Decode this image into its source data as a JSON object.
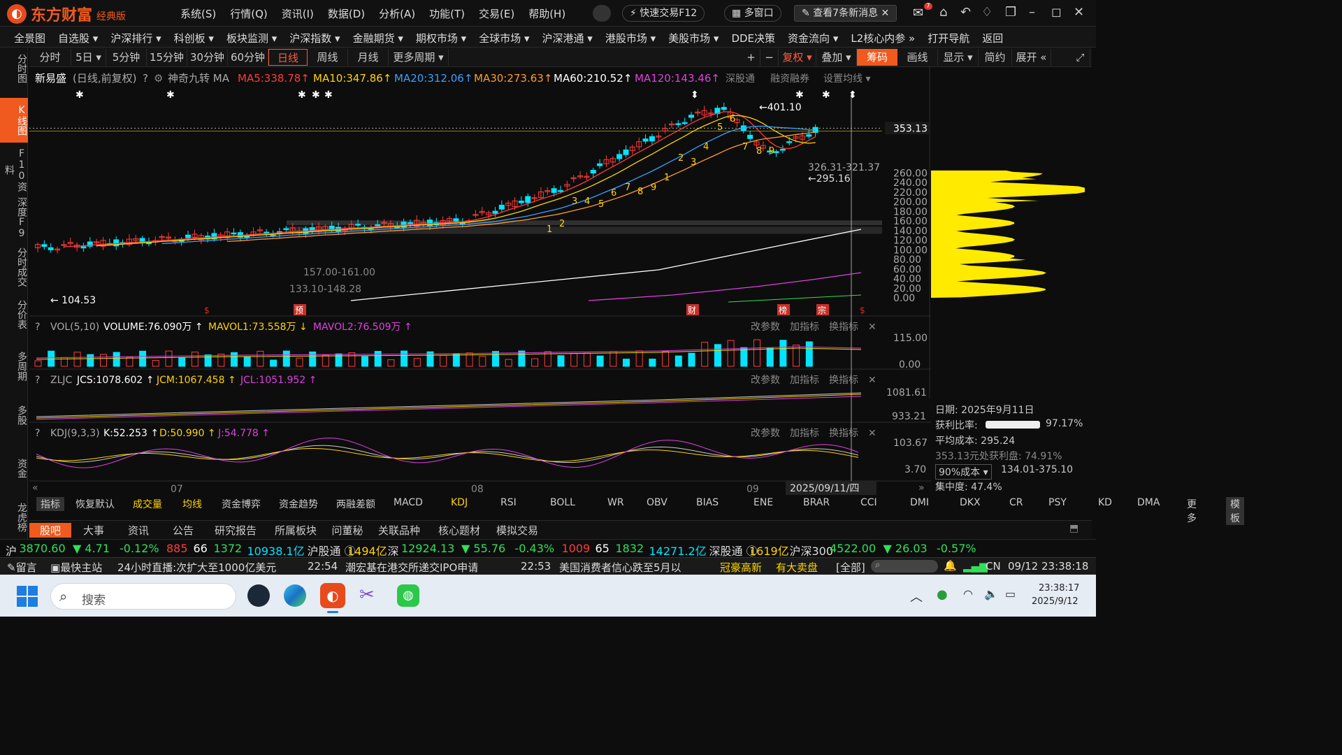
{
  "app": {
    "name": "东方财富",
    "edition": "经典版"
  },
  "top_menu": [
    "系统(S)",
    "行情(Q)",
    "资讯(I)",
    "数据(D)",
    "分析(A)",
    "功能(T)",
    "交易(E)",
    "帮助(H)"
  ],
  "top_right": {
    "quick_trade": "快速交易F12",
    "multi_window": "多窗口",
    "news_notice": "查看7条新消息",
    "badge": "7"
  },
  "navbar": [
    "全景图",
    "自选股 ▾",
    "沪深排行 ▾",
    "科创板 ▾",
    "板块监测 ▾",
    "沪深指数 ▾",
    "金融期货 ▾",
    "期权市场 ▾",
    "全球市场 ▾",
    "沪深港通 ▾",
    "港股市场 ▾",
    "美股市场 ▾",
    "DDE决策",
    "资金流向 ▾",
    "L2核心内参 »",
    "打开导航",
    "返回"
  ],
  "leftbar": [
    {
      "label": "分时图",
      "active": false
    },
    {
      "label": "K线图",
      "active": true
    },
    {
      "label": "F10资料",
      "active": false
    },
    {
      "label": "深度F9",
      "active": false
    },
    {
      "label": "分时成交",
      "active": false
    },
    {
      "label": "分价表",
      "active": false
    },
    {
      "label": "多周期",
      "active": false
    },
    {
      "label": "多股",
      "active": false
    },
    {
      "label": "资金",
      "active": false
    },
    {
      "label": "龙虎榜",
      "active": false
    }
  ],
  "periods": [
    "分时",
    "5日 ▾",
    "5分钟",
    "15分钟",
    "30分钟",
    "60分钟",
    "日线",
    "周线",
    "月线",
    "更多周期 ▾"
  ],
  "active_period": "日线",
  "chart_tools": [
    "+",
    "−",
    "复权 ▾",
    "叠加 ▾",
    "筹码",
    "画线",
    "显示 ▾",
    "简约",
    "展开 «"
  ],
  "stock": {
    "name": "新易盛",
    "mode": "(日线,前复权)",
    "indicator": "神奇九转 MA"
  },
  "ma_values": [
    {
      "label": "MA5:338.78",
      "arrow": "↑",
      "color": "#ff3b3b"
    },
    {
      "label": "MA10:347.86",
      "arrow": "↑",
      "color": "#ffd400"
    },
    {
      "label": "MA20:312.06",
      "arrow": "↑",
      "color": "#3aa0ff"
    },
    {
      "label": "MA30:273.63",
      "arrow": "↑",
      "color": "#ff9b2f"
    },
    {
      "label": "MA60:210.52",
      "arrow": "↑",
      "color": "#ffffff"
    },
    {
      "label": "MA120:143.46",
      "arrow": "↑",
      "color": "#e040e0"
    }
  ],
  "ma_extra": [
    "深股通",
    "融资融券",
    "设置均线 ▾"
  ],
  "price_axis": [
    "260.00",
    "240.00",
    "220.00",
    "200.00",
    "180.00",
    "160.00",
    "140.00",
    "120.00",
    "100.00",
    "80.00",
    "60.00",
    "40.00",
    "20.00",
    "0.00"
  ],
  "current_price": "353.13",
  "annotations": {
    "high": "401.10",
    "low": "104.53",
    "range1": "326.31-321.37",
    "range2": "295.16",
    "band1": "157.00-161.00",
    "band2": "133.10-148.28"
  },
  "markers": [
    "预",
    "财",
    "榜",
    "宗"
  ],
  "vol": {
    "title": "VOL(5,10)",
    "volume": "VOLUME:76.090万",
    "ma1": "MAVOL1:73.558万",
    "ma2": "MAVOL2:76.509万",
    "axis": [
      "115.00",
      "0.00"
    ]
  },
  "zljc": {
    "title": "ZLJC",
    "jcs": "JCS:1078.602",
    "jcm": "JCM:1067.458",
    "jcl": "JCL:1051.952",
    "axis": [
      "1081.61",
      "933.21"
    ]
  },
  "kdj": {
    "title": "KDJ(9,3,3)",
    "k": "K:52.253",
    "d": "D:50.990",
    "j": "J:54.778",
    "axis": [
      "103.67",
      "3.70"
    ]
  },
  "panel_actions": [
    "改参数",
    "加指标",
    "换指标"
  ],
  "x_axis": [
    "07",
    "08",
    "09"
  ],
  "x_current": "2025/09/11/四",
  "chip": {
    "date": "日期: 2025年9月11日",
    "profit_ratio_label": "获利比率:",
    "profit_ratio": "97.17%",
    "avg_cost": "平均成本: 295.24",
    "profit_at": "353.13元处获利盘: 74.91%",
    "cost_select": "90%成本 ▾",
    "cost_range": "134.01-375.10",
    "concentration": "集中度: 47.4%"
  },
  "indicator_tabs": [
    "指标",
    "恢复默认",
    "成交量",
    "均线",
    "资金博弈",
    "资金趋势",
    "两融差额",
    "MACD",
    "KDJ",
    "RSI",
    "BOLL",
    "WR",
    "OBV",
    "BIAS",
    "ENE",
    "BRAR",
    "CCI",
    "DMI",
    "DKX",
    "CR",
    "PSY",
    "KD",
    "DMA",
    "更多",
    "模板"
  ],
  "news_tabs": [
    "股吧",
    "大事",
    "资讯",
    "公告",
    "研究报告",
    "所属板块",
    "问董秘",
    "关联品种",
    "核心题材",
    "模拟交易"
  ],
  "indexbar": [
    {
      "t": "沪",
      "c": "#ddd"
    },
    {
      "t": "3870.60",
      "c": "#2fe05a"
    },
    {
      "t": "▼ 4.71",
      "c": "#2fe05a"
    },
    {
      "t": "-0.12%",
      "c": "#2fe05a"
    },
    {
      "t": "885",
      "c": "#ff3b3b"
    },
    {
      "t": "66",
      "c": "#fff"
    },
    {
      "t": "1372",
      "c": "#2fe05a"
    },
    {
      "t": "10938.1亿",
      "c": "#00e5ff"
    },
    {
      "t": "沪股通 ⓘ",
      "c": "#ddd"
    },
    {
      "t": "1494亿",
      "c": "#ffd400"
    },
    {
      "t": "深",
      "c": "#ddd"
    },
    {
      "t": "12924.13",
      "c": "#2fe05a"
    },
    {
      "t": "▼ 55.76",
      "c": "#2fe05a"
    },
    {
      "t": "-0.43%",
      "c": "#2fe05a"
    },
    {
      "t": "1009",
      "c": "#ff3b3b"
    },
    {
      "t": "65",
      "c": "#fff"
    },
    {
      "t": "1832",
      "c": "#2fe05a"
    },
    {
      "t": "14271.2亿",
      "c": "#00e5ff"
    },
    {
      "t": "深股通 ⓘ",
      "c": "#ddd"
    },
    {
      "t": "1619亿",
      "c": "#ffd400"
    },
    {
      "t": "沪深300",
      "c": "#ddd"
    },
    {
      "t": "4522.00",
      "c": "#2fe05a"
    },
    {
      "t": "▼ 26.03",
      "c": "#2fe05a"
    },
    {
      "t": "-0.57%",
      "c": "#2fe05a"
    }
  ],
  "ticker": {
    "left1": "留言",
    "left2": "最快主站",
    "news1": "24小时直播:次扩大至1000亿美元",
    "time1": "22:54",
    "news2": "潮宏基在港交所递交IPO申请",
    "time2": "22:53",
    "news3": "美国消费者信心跌至5月以",
    "tag1": "冠豪高新",
    "tag2": "有大卖盘",
    "all": "[全部]",
    "region": "CN",
    "datetime": "09/12 23:38:18"
  },
  "taskbar": {
    "search": "搜索",
    "time": "23:38:17",
    "date": "2025/9/12"
  },
  "colors": {
    "up": "#ff3b3b",
    "down": "#00e5ff",
    "accent": "#f05a1e",
    "chip": "#ffea00"
  }
}
